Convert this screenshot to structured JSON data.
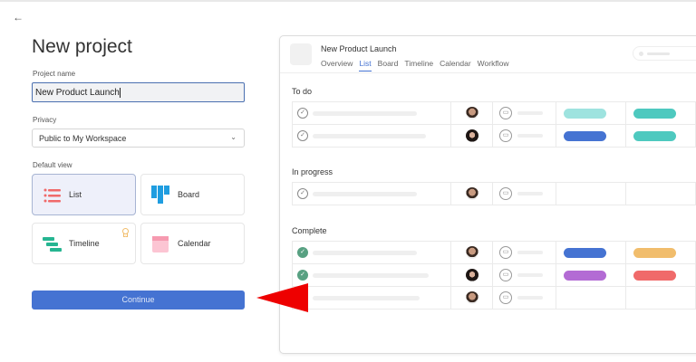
{
  "form": {
    "back_icon": "←",
    "title": "New project",
    "project_name_label": "Project name",
    "project_name_value": "New Product Launch",
    "privacy_label": "Privacy",
    "privacy_value": "Public to My Workspace",
    "default_view_label": "Default view",
    "views": [
      {
        "label": "List",
        "icon": "list-icon",
        "selected": true
      },
      {
        "label": "Board",
        "icon": "board-icon",
        "selected": false
      },
      {
        "label": "Timeline",
        "icon": "timeline-icon",
        "selected": false,
        "premium": true
      },
      {
        "label": "Calendar",
        "icon": "calendar-icon",
        "selected": false
      }
    ],
    "continue_label": "Continue"
  },
  "preview": {
    "title": "New Product Launch",
    "tabs": [
      "Overview",
      "List",
      "Board",
      "Timeline",
      "Calendar",
      "Workflow"
    ],
    "active_tab": "List",
    "sections": [
      {
        "name": "To do",
        "rows": [
          {
            "done": false,
            "avatar": "m",
            "tags": [
              "#9ee3df",
              "#4ec9bf"
            ]
          },
          {
            "done": false,
            "avatar": "f",
            "tags": [
              "#4573d2",
              "#4ec9bf"
            ]
          }
        ]
      },
      {
        "name": "In progress",
        "rows": [
          {
            "done": false,
            "avatar": "m",
            "tags": []
          }
        ]
      },
      {
        "name": "Complete",
        "rows": [
          {
            "done": true,
            "avatar": "m",
            "tags": [
              "#4573d2",
              "#f1bd6c"
            ]
          },
          {
            "done": true,
            "avatar": "f",
            "tags": [
              "#b36bd4",
              "#f06a6a"
            ]
          },
          {
            "done": true,
            "avatar": "m",
            "tags": []
          }
        ]
      }
    ]
  },
  "annotation": {
    "arrow_color": "#ee0000"
  }
}
